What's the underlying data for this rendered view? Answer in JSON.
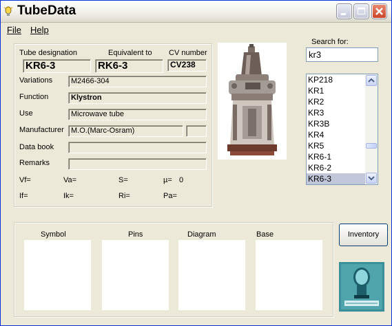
{
  "window": {
    "title": "TubeData"
  },
  "menu": {
    "file": "File",
    "help": "Help"
  },
  "tube": {
    "designation_label": "Tube designation",
    "designation": "KR6-3",
    "equivalent_label": "Equivalent to",
    "equivalent": "RK6-3",
    "cv_label": "CV number",
    "cv": "CV238",
    "variations_label": "Variations",
    "variations": "M2466-304",
    "function_label": "Function",
    "function": "Klystron",
    "use_label": "Use",
    "use": "Microwave tube",
    "manufacturer_label": "Manufacturer",
    "manufacturer": "M.O.(Marc-Osram)",
    "manufacturer_extra": "",
    "databook_label": "Data book",
    "databook": "",
    "remarks_label": "Remarks",
    "remarks": "",
    "params": {
      "vf": "Vf=",
      "va": "Va=",
      "s": "S=",
      "mu": "µ=",
      "mu_value": "0",
      "if": "If=",
      "ik": "Ik=",
      "ri": "Ri=",
      "pa": "Pa="
    }
  },
  "search": {
    "label": "Search for:",
    "value": "kr3",
    "results": [
      "KP218",
      "KR1",
      "KR2",
      "KR3",
      "KR3B",
      "KR4",
      "KR5",
      "KR6-1",
      "KR6-2",
      "KR6-3"
    ],
    "selected": "KR6-3"
  },
  "bottom": {
    "symbol": "Symbol",
    "pins": "Pins",
    "diagram": "Diagram",
    "base": "Base",
    "inventory": "Inventory"
  },
  "colors": {
    "titlebar": "#f1f0ea",
    "window": "#ece9d8",
    "close": "#d9593f",
    "selection": "#c1c6d9"
  },
  "icons": {
    "app": "lightbulb-icon",
    "minimize": "minimize-icon",
    "maximize": "maximize-icon",
    "close": "close-icon"
  }
}
